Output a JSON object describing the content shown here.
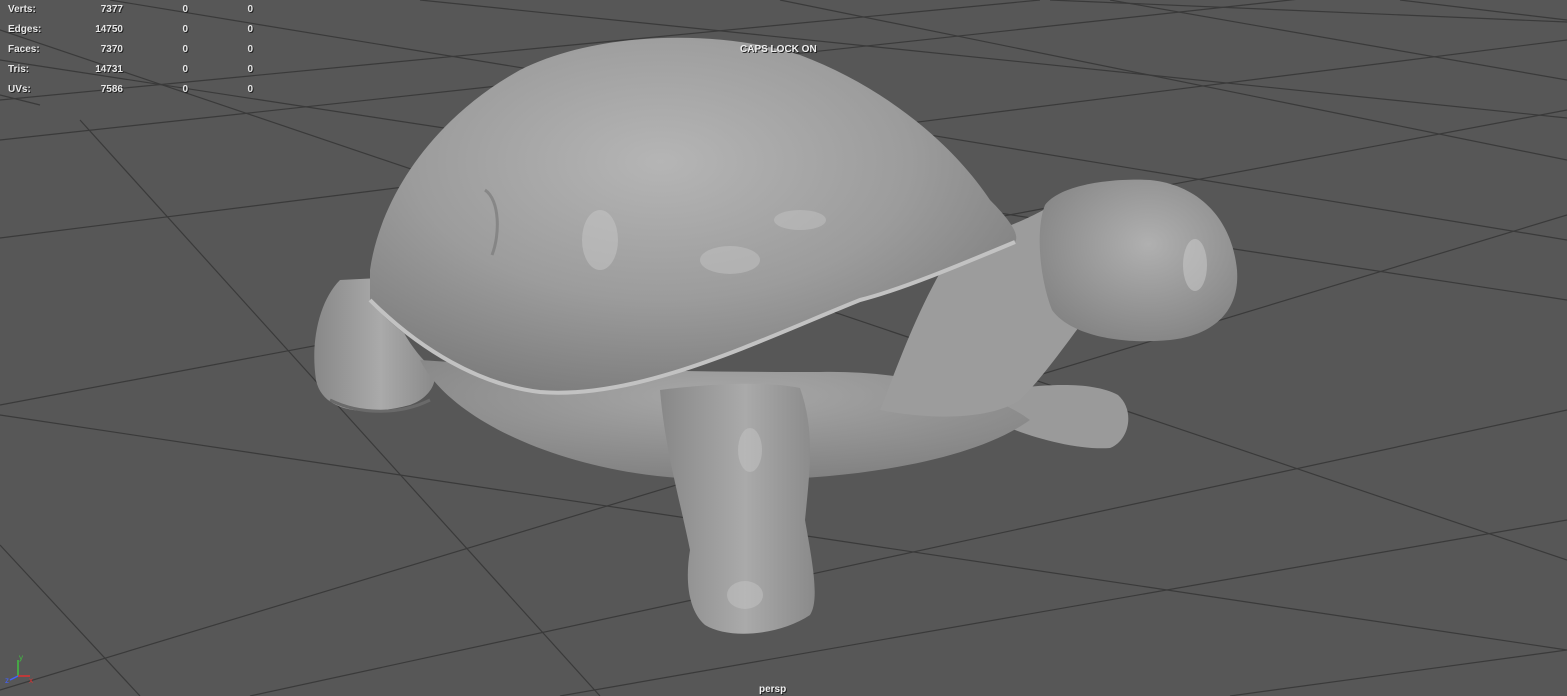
{
  "viewport": {
    "camera": "persp",
    "status_message": "CAPS LOCK ON"
  },
  "heads_up_display": {
    "poly_count": [
      {
        "label": "Verts:",
        "values": [
          "7377",
          "0",
          "0"
        ]
      },
      {
        "label": "Edges:",
        "values": [
          "14750",
          "0",
          "0"
        ]
      },
      {
        "label": "Faces:",
        "values": [
          "7370",
          "0",
          "0"
        ]
      },
      {
        "label": "Tris:",
        "values": [
          "14731",
          "0",
          "0"
        ]
      },
      {
        "label": "UVs:",
        "values": [
          "7586",
          "0",
          "0"
        ]
      }
    ]
  },
  "axis_indicator": {
    "labels": [
      "y",
      "z",
      "x"
    ],
    "colors": {
      "x": "#e03030",
      "y": "#40c040",
      "z": "#4060ff"
    }
  },
  "colors": {
    "viewport_background": "#575757",
    "grid_line": "#3a3a3a",
    "model": "#9a9a9a"
  },
  "scene": {
    "model": "turtle-mesh"
  }
}
